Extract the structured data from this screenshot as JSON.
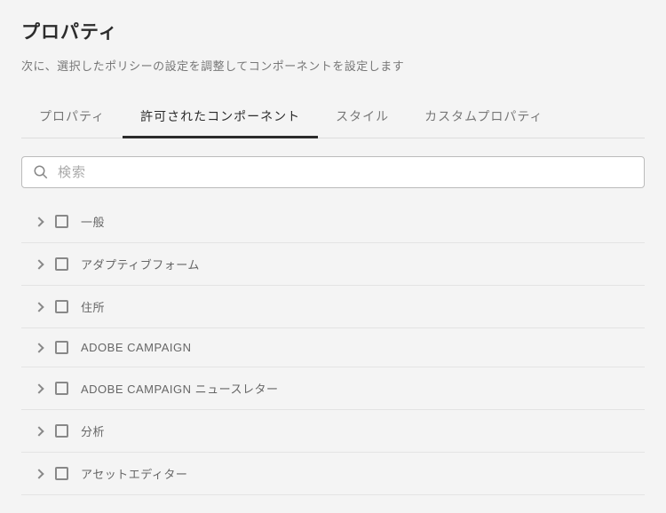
{
  "title": "プロパティ",
  "description": "次に、選択したポリシーの設定を調整してコンポーネントを設定します",
  "tabs": [
    {
      "label": "プロパティ",
      "active": false
    },
    {
      "label": "許可されたコンポーネント",
      "active": true
    },
    {
      "label": "スタイル",
      "active": false
    },
    {
      "label": "カスタムプロパティ",
      "active": false
    }
  ],
  "search": {
    "placeholder": "検索",
    "value": ""
  },
  "groups": [
    {
      "label": "一般"
    },
    {
      "label": "アダプティブフォーム"
    },
    {
      "label": "住所"
    },
    {
      "label": "ADOBE CAMPAIGN"
    },
    {
      "label": "ADOBE CAMPAIGN ニュースレター"
    },
    {
      "label": "分析"
    },
    {
      "label": "アセットエディター"
    }
  ]
}
